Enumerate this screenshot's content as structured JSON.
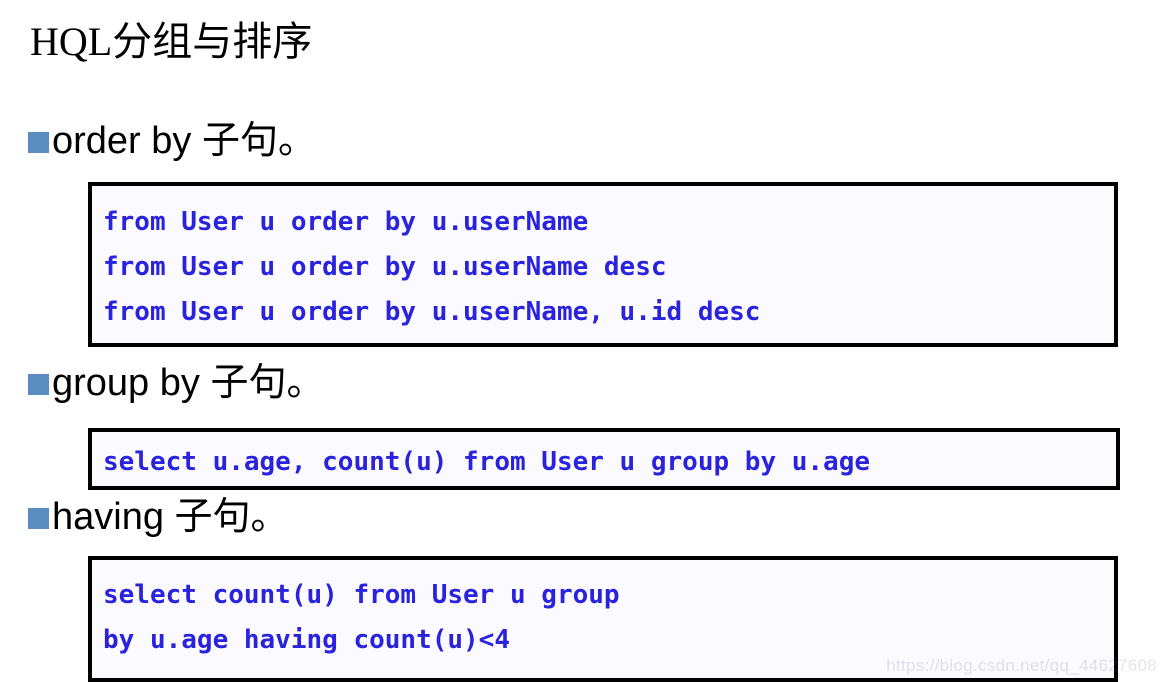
{
  "slide": {
    "title": "HQL分组与排序",
    "bullet_color": "#5b8cc0",
    "code_text_color": "#2a22dd",
    "code_bg_color": "#fafaff",
    "code_border_color": "#000000",
    "sections": [
      {
        "bullet_label": "order by 子句。",
        "code_lines": [
          "from User u order by u.userName",
          "from User u order by u.userName desc",
          "from User u order by u.userName, u.id desc"
        ]
      },
      {
        "bullet_label": "group by 子句。",
        "code_lines": [
          "select u.age, count(u) from User u group by u.age"
        ]
      },
      {
        "bullet_label": "having 子句。",
        "code_lines": [
          "select count(u) from User u group",
          "by u.age having count(u)<4"
        ]
      }
    ]
  },
  "watermark": {
    "text": "https://blog.csdn.net/qq_44627608"
  }
}
